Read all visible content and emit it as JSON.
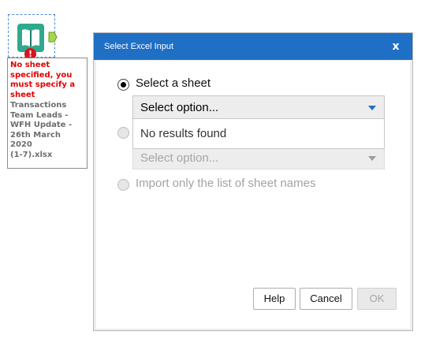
{
  "canvas": {
    "tool": {
      "icon": "excel-book-icon",
      "error_badge": "!",
      "annotation": {
        "error_lines": [
          "No sheet",
          "specified, you",
          "must specify a",
          "sheet"
        ],
        "file_lines": [
          "Transactions",
          "Team Leads -",
          "WFH Update -",
          "26th March 2020",
          "(1-7).xlsx"
        ]
      }
    }
  },
  "dialog": {
    "title": "Select Excel Input",
    "close_label": "x",
    "options": [
      {
        "label": "Select a sheet",
        "selected": true
      },
      {
        "label": "",
        "selected": false
      },
      {
        "label": "Import only the list of sheet names",
        "selected": false
      }
    ],
    "sheet_select": {
      "value": "Select option...",
      "dropdown_text": "No results found"
    },
    "second_select": {
      "value": "Select option..."
    },
    "buttons": {
      "help": "Help",
      "cancel": "Cancel",
      "ok": "OK"
    }
  },
  "colors": {
    "title_bar": "#1f6fc5",
    "error": "#e00000",
    "accent": "#1f6fc5"
  }
}
